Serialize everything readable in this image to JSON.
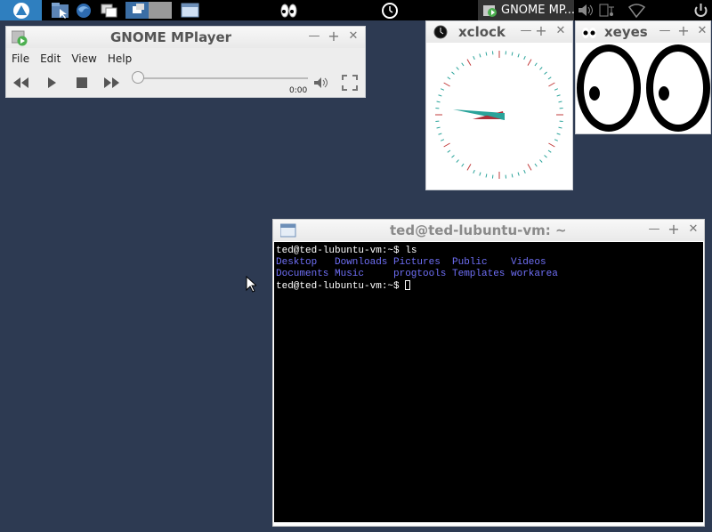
{
  "panel": {
    "task_title": "GNOME MP...",
    "icons": [
      "lubuntu-start-icon",
      "file-manager-icon",
      "firefox-icon",
      "window-switcher-icon",
      "desktop-pager-icon",
      "show-desktop-icon",
      "xeyes-launcher-icon",
      "clock-icon",
      "volume-icon",
      "battery-icon",
      "wifi-icon",
      "power-icon"
    ]
  },
  "mplayer": {
    "title": "GNOME MPlayer",
    "menu": [
      "File",
      "Edit",
      "View",
      "Help"
    ],
    "time": "0:00"
  },
  "xclock": {
    "title": "xclock"
  },
  "xeyes": {
    "title": "xeyes"
  },
  "terminal": {
    "title": "ted@ted-lubuntu-vm: ~",
    "prompt1": "ted@ted-lubuntu-vm:~$ ls",
    "dirs_row1": [
      "Desktop",
      "Downloads",
      "Pictures",
      "Public",
      "Videos"
    ],
    "dirs_row2": [
      "Documents",
      "Music",
      "progtools",
      "Templates",
      "workarea"
    ],
    "prompt2": "ted@ted-lubuntu-vm:~$ "
  },
  "colors": {
    "desktop": "#2d3a52",
    "dir_blue": "#6f6ff7",
    "clock_hand": "#2aa39a"
  }
}
